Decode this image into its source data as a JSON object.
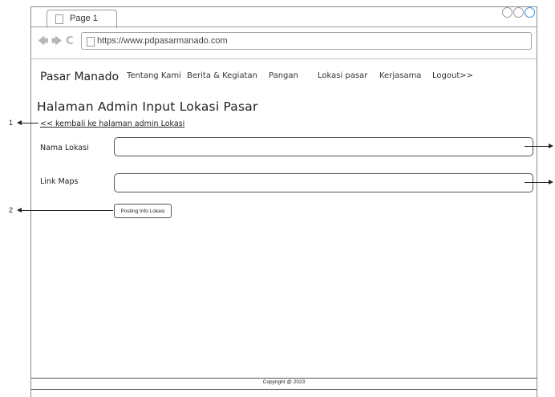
{
  "browser": {
    "tab_title": "Page 1",
    "url": "https://www.pdpasarmanado.com"
  },
  "header": {
    "brand": "Pasar Manado",
    "menu": [
      "Tentang Kami",
      "Berita & Kegiatan",
      "Pangan",
      "Lokasi pasar",
      "Kerjasama",
      "Logout>>"
    ]
  },
  "main": {
    "title": "Halaman Admin Input Lokasi Pasar",
    "back_link": "<< kembali ke halaman admin Lokasi",
    "fields": [
      {
        "label": "Nama Lokasi",
        "value": ""
      },
      {
        "label": "Link Maps",
        "value": ""
      }
    ],
    "submit_label": "Posting Info Lokasi"
  },
  "footer": {
    "copyright": "Copyright @ 2023"
  },
  "annotations": [
    "1",
    "2"
  ]
}
